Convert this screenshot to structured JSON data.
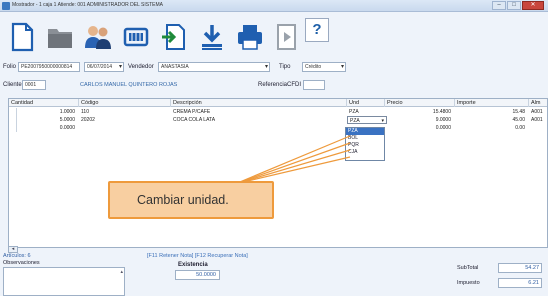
{
  "window": {
    "title": "Mostrador - 1 caja 1   Atiende: 001 ADMINISTRADOR DEL SISTEMA",
    "controls": {
      "minimize": "–",
      "maximize": "□",
      "close": "✕"
    }
  },
  "toolbar": {
    "buttons": [
      {
        "name": "new-document",
        "icon": "document-icon"
      },
      {
        "name": "folder",
        "icon": "folder-icon"
      },
      {
        "name": "customers",
        "icon": "people-icon"
      },
      {
        "name": "card",
        "icon": "card-icon"
      },
      {
        "name": "import",
        "icon": "import-icon"
      },
      {
        "name": "download",
        "icon": "download-icon"
      },
      {
        "name": "print",
        "icon": "printer-icon"
      },
      {
        "name": "exit",
        "icon": "exit-icon"
      }
    ],
    "help_label": "?"
  },
  "form": {
    "folio_label": "Folio",
    "folio_value": "PE2007950000000814",
    "date_value": "06/07/2014",
    "vendedor_label": "Vendedor",
    "vendedor_value": "ANASTASIA",
    "tipo_label": "Tipo",
    "tipo_value": "Crédito",
    "cliente_label": "Cliente",
    "cliente_value": "0001",
    "cliente_name": "CARLOS MANUEL QUINTERO ROJAS",
    "referencia_label": "ReferenciaCFDI",
    "referencia_value": ""
  },
  "grid": {
    "headers": {
      "cantidad": "Cantidad",
      "codigo": "Código",
      "descripcion": "Descripción",
      "und": "Und",
      "precio": "Precio",
      "importe": "Importe",
      "alm": "Alm"
    },
    "rows": [
      {
        "cantidad": "1.0000",
        "codigo": "110",
        "descripcion": "CREMA P/CAFE",
        "und": "PZA",
        "precio": "15.4800",
        "importe": "15.48",
        "alm": "A001"
      },
      {
        "cantidad": "5.0000",
        "codigo": "20202",
        "descripcion": "COCA COLA LATA",
        "und": "PZA",
        "precio": "9.0000",
        "importe": "45.00",
        "alm": "A001"
      },
      {
        "cantidad": "0.0000",
        "codigo": "",
        "descripcion": "",
        "und": "",
        "precio": "0.0000",
        "importe": "0.00",
        "alm": ""
      }
    ],
    "unit_options": [
      "PZA",
      "BOL",
      "PQR",
      "CJA"
    ],
    "selected_unit": "PZA"
  },
  "callout": {
    "text": "Cambiar unidad."
  },
  "footer": {
    "articulos": "Artículos: 6",
    "observaciones_label": "Observaciones",
    "notas": "[F11 Retener Nota]  [F12 Recuperar Nota]",
    "existencia_label": "Existencia",
    "existencia_value": "50.0000",
    "subtotal_label": "SubTotal",
    "subtotal_value": "54.27",
    "impuesto_label": "Impuesto",
    "impuesto_value": "6.21"
  },
  "colors": {
    "callout_fill": "#f8cfa1",
    "callout_border": "#ee9a3c",
    "selection": "#3a72c2",
    "link_blue": "#2f5ea3"
  }
}
